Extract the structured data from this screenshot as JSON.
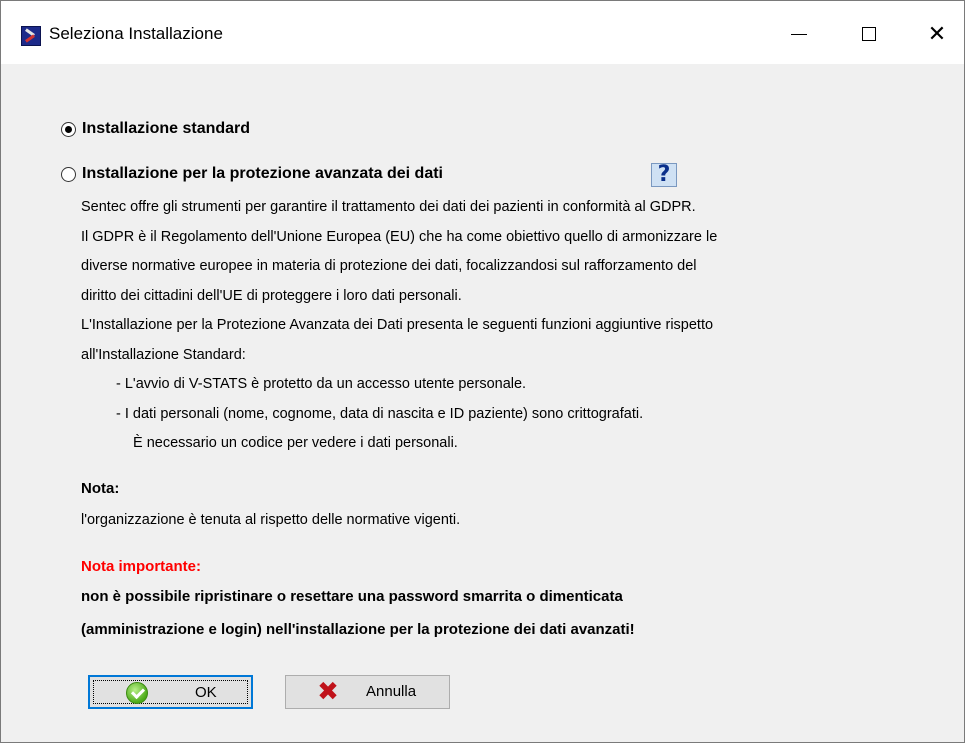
{
  "window": {
    "title": "Seleziona Installazione",
    "icon": "app-icon",
    "controls": {
      "minimize": "—",
      "maximize": "☐",
      "close": "✕"
    }
  },
  "options": {
    "standard": {
      "label": "Installazione standard",
      "selected": true
    },
    "advanced": {
      "label": "Installazione per la protezione avanzata dei dati",
      "selected": false,
      "help_label": "?"
    }
  },
  "description": [
    "Sentec offre gli strumenti per garantire il trattamento dei dati dei pazienti in conformità al GDPR.",
    "Il GDPR è il Regolamento dell'Unione Europea (EU) che ha come obiettivo quello di armonizzare le",
    "diverse normative europee in materia di protezione dei dati, focalizzandosi sul rafforzamento del",
    "diritto dei cittadini dell'UE di proteggere i loro dati personali.",
    "L'Installazione per la Protezione Avanzata dei Dati presenta le seguenti funzioni aggiuntive rispetto",
    "all'Installazione Standard:",
    "- L'avvio di V-STATS è protetto da un accesso utente personale.",
    "- I dati personali (nome, cognome, data di nascita e ID paziente) sono crittografati.",
    "È necessario un codice per vedere i dati personali."
  ],
  "nota": {
    "heading": "Nota:",
    "text": "l'organizzazione è tenuta al rispetto delle normative vigenti."
  },
  "important": {
    "heading": "Nota importante:",
    "line1": "non è possibile ripristinare o resettare una password smarrita o dimenticata",
    "line2": "(amministrazione e login) nell'installazione per la protezione dei dati avanzati!",
    "color": "#ff0000"
  },
  "buttons": {
    "ok": {
      "label": "OK",
      "icon": "check-icon"
    },
    "cancel": {
      "label": "Annulla",
      "icon": "x-icon"
    }
  }
}
